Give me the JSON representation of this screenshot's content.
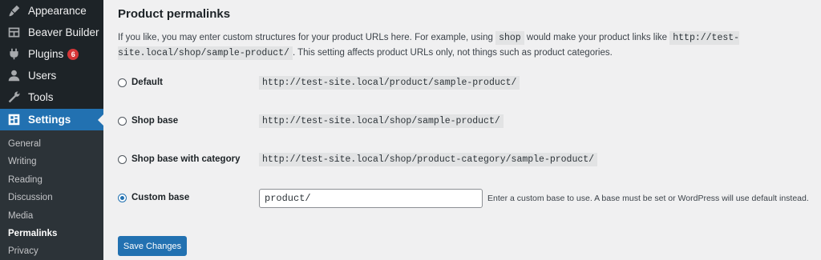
{
  "sidebar": {
    "items": [
      {
        "label": "Appearance",
        "icon": "brush-icon"
      },
      {
        "label": "Beaver Builder",
        "icon": "layout-icon"
      },
      {
        "label": "Plugins",
        "icon": "plug-icon",
        "badge": "6"
      },
      {
        "label": "Users",
        "icon": "user-icon"
      },
      {
        "label": "Tools",
        "icon": "wrench-icon"
      },
      {
        "label": "Settings",
        "icon": "settings-icon",
        "active": true
      }
    ],
    "submenu": [
      "General",
      "Writing",
      "Reading",
      "Discussion",
      "Media",
      "Permalinks",
      "Privacy"
    ],
    "current_submenu": "Permalinks"
  },
  "main": {
    "title": "Product permalinks",
    "desc_1": "If you like, you may enter custom structures for your product URLs here. For example, using",
    "desc_code_1": "shop",
    "desc_2": "would make your product links like",
    "desc_code_2": "http://test-site.local/shop/sample-product/",
    "desc_3": ". This setting affects product URLs only, not things such as product categories.",
    "options": [
      {
        "label": "Default",
        "example": "http://test-site.local/product/sample-product/",
        "checked": false
      },
      {
        "label": "Shop base",
        "example": "http://test-site.local/shop/sample-product/",
        "checked": false
      },
      {
        "label": "Shop base with category",
        "example": "http://test-site.local/shop/product-category/sample-product/",
        "checked": false
      },
      {
        "label": "Custom base",
        "value": "product/",
        "checked": true
      }
    ],
    "custom_help": "Enter a custom base to use. A base must be set or WordPress will use default instead.",
    "save_label": "Save Changes"
  },
  "colors": {
    "accent": "#2271b1",
    "sidebar_bg": "#1d2327",
    "badge": "#d63638"
  }
}
